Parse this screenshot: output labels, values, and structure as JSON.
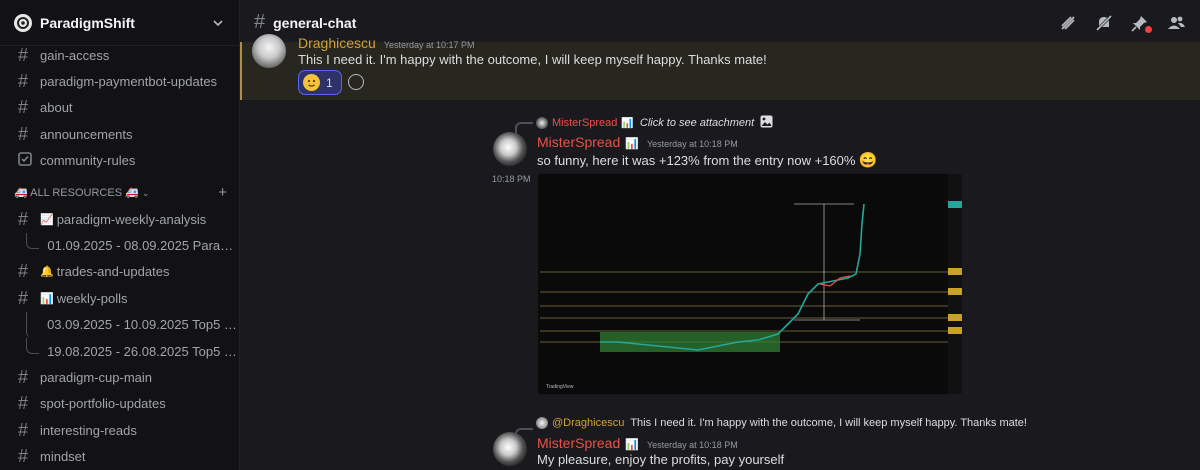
{
  "server": {
    "name": "ParadigmShift"
  },
  "sidebar": {
    "channels_top": [
      {
        "label": "gain-access"
      },
      {
        "label": "paradigm-paymentbot-updates"
      },
      {
        "label": "about"
      },
      {
        "label": "announcements"
      }
    ],
    "rules": {
      "label": "community-rules"
    },
    "category": {
      "label": "🚑 ALL RESOURCES 🚑"
    },
    "resources": {
      "weekly_analysis": {
        "emoji": "📈",
        "label": "paradigm-weekly-analysis"
      },
      "weekly_analysis_thread": {
        "label": "01.09.2025 - 08.09.2025 Paradig..."
      },
      "trades": {
        "emoji": "🔔",
        "label": "trades-and-updates"
      },
      "polls": {
        "emoji": "📊",
        "label": "weekly-polls"
      },
      "polls_thread_1": {
        "label": "03.09.2025 - 10.09.2025 Top5 We..."
      },
      "polls_thread_2": {
        "label": "19.08.2025 - 26.08.2025 Top5 We..."
      }
    },
    "channels_bottom": [
      {
        "label": "paradigm-cup-main"
      },
      {
        "label": "spot-portfolio-updates"
      },
      {
        "label": "interesting-reads"
      },
      {
        "label": "mindset"
      }
    ]
  },
  "channel": {
    "title": "general-chat"
  },
  "messages": {
    "m1": {
      "author": "Draghicescu",
      "timestamp": "Yesterday at 10:17 PM",
      "text": "This I need it. I'm happy with the outcome, I will keep myself happy. Thanks mate!",
      "reaction_count": "1"
    },
    "m2": {
      "reply_author": "MisterSpread",
      "reply_badge": "📊",
      "reply_text": "Click to see attachment",
      "author": "MisterSpread",
      "badge": "📊",
      "timestamp": "Yesterday at 10:18 PM",
      "text": "so funny, here it was +123% from the entry now +160%",
      "emoji": "😄",
      "followup_time": "10:18 PM",
      "chart_footer": "TradingView"
    },
    "m3": {
      "reply_author": "@Draghicescu",
      "reply_text": "This I need it. I'm happy with the outcome, I will keep myself happy. Thanks mate!",
      "author": "MisterSpread",
      "badge": "📊",
      "timestamp": "Yesterday at 10:18 PM",
      "text": "My pleasure, enjoy the profits, pay yourself"
    }
  },
  "colors": {
    "username_draghicescu": "#d1a23a",
    "username_misterspread": "#e8524a",
    "highlight_bg": "#27261f",
    "highlight_border": "#b08f40",
    "accent": "#5865f2"
  }
}
